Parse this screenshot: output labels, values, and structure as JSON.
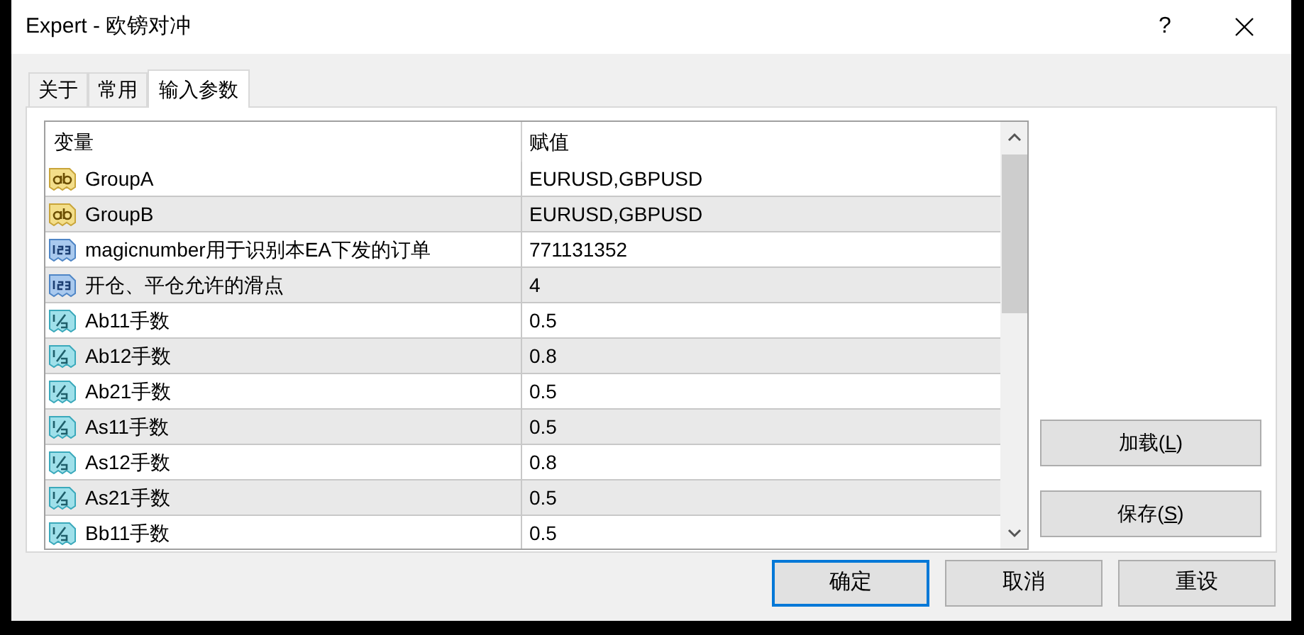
{
  "window": {
    "title": "Expert - 欧镑对冲",
    "help": "?"
  },
  "tabs": [
    {
      "label": "关于",
      "selected": false
    },
    {
      "label": "常用",
      "selected": false
    },
    {
      "label": "输入参数",
      "selected": true
    }
  ],
  "table": {
    "columns": [
      "变量",
      "赋值"
    ],
    "rows": [
      {
        "kind": "string",
        "name": "GroupA",
        "value": "EURUSD,GBPUSD"
      },
      {
        "kind": "string",
        "name": "GroupB",
        "value": "EURUSD,GBPUSD"
      },
      {
        "kind": "int",
        "name": "magicnumber用于识别本EA下发的订单",
        "value": "771131352"
      },
      {
        "kind": "int",
        "name": "开仓、平仓允许的滑点",
        "value": "4"
      },
      {
        "kind": "double",
        "name": "Ab11手数",
        "value": "0.5"
      },
      {
        "kind": "double",
        "name": "Ab12手数",
        "value": "0.8"
      },
      {
        "kind": "double",
        "name": "Ab21手数",
        "value": "0.5"
      },
      {
        "kind": "double",
        "name": "As11手数",
        "value": "0.5"
      },
      {
        "kind": "double",
        "name": "As12手数",
        "value": "0.8"
      },
      {
        "kind": "double",
        "name": "As21手数",
        "value": "0.5"
      },
      {
        "kind": "double",
        "name": "Bb11手数",
        "value": "0.5"
      }
    ]
  },
  "side_buttons": [
    {
      "before": "加载(",
      "key": "L",
      "after": ")"
    },
    {
      "before": "保存(",
      "key": "S",
      "after": ")"
    }
  ],
  "buttons": [
    {
      "label": "确定",
      "default": true
    },
    {
      "label": "取消",
      "default": false
    },
    {
      "label": "重设",
      "default": false
    }
  ]
}
